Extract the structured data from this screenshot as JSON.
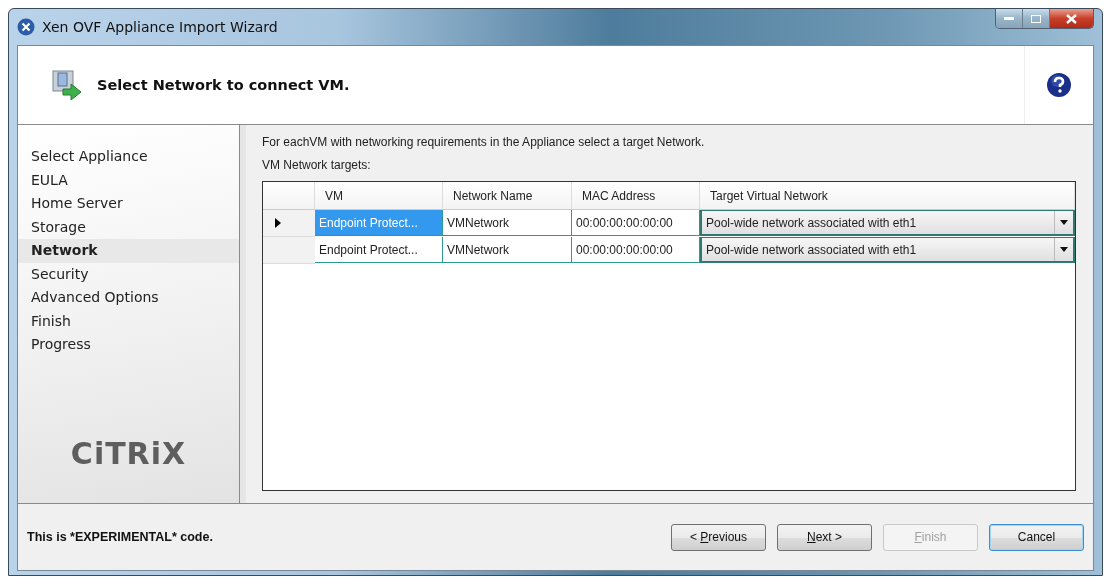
{
  "window": {
    "title": "Xen OVF Appliance Import Wizard"
  },
  "header": {
    "title": "Select Network to connect VM."
  },
  "sidebar": {
    "items": [
      {
        "label": "Select Appliance",
        "selected": false
      },
      {
        "label": "EULA",
        "selected": false
      },
      {
        "label": "Home Server",
        "selected": false
      },
      {
        "label": "Storage",
        "selected": false
      },
      {
        "label": "Network",
        "selected": true
      },
      {
        "label": "Security",
        "selected": false
      },
      {
        "label": "Advanced Options",
        "selected": false
      },
      {
        "label": "Finish",
        "selected": false
      },
      {
        "label": "Progress",
        "selected": false
      }
    ],
    "logo": "CiTRiX"
  },
  "content": {
    "instruction": "For eachVM with networking requirements in the Appliance select a target Network.",
    "table_label": "VM Network targets:"
  },
  "table": {
    "columns": [
      "VM",
      "Network Name",
      "MAC Address",
      "Target Virtual Network"
    ],
    "rows": [
      {
        "selected": true,
        "vm": "Endpoint Protect...",
        "network_name": "VMNetwork",
        "mac": "00:00:00:00:00:00",
        "target": "Pool-wide network associated with eth1"
      },
      {
        "selected": false,
        "vm": "Endpoint Protect...",
        "network_name": "VMNetwork",
        "mac": "00:00:00:00:00:00",
        "target": "Pool-wide network associated with eth1"
      }
    ]
  },
  "status_bar": {
    "text": "This is *EXPERIMENTAL* code."
  },
  "buttons": [
    {
      "label_parts": {
        "before": "< ",
        "key": "P",
        "after": "revious"
      },
      "disabled": false,
      "default": false
    },
    {
      "label_parts": {
        "key": "N",
        "after": "ext >"
      },
      "disabled": false,
      "default": false
    },
    {
      "label_parts": {
        "key": "F",
        "after": "inish"
      },
      "disabled": true,
      "default": false
    },
    {
      "label_parts": {
        "after": "Cancel"
      },
      "disabled": false,
      "default": true
    }
  ]
}
